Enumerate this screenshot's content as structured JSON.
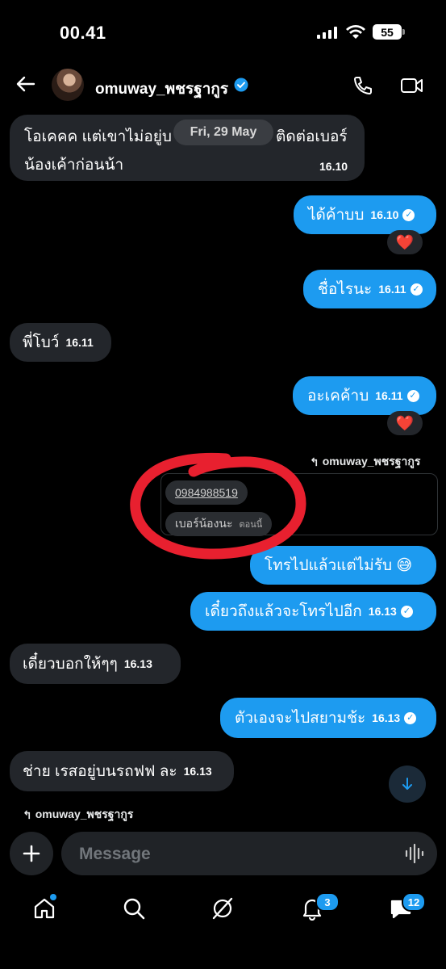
{
  "status_bar": {
    "time": "00.41",
    "battery": "55"
  },
  "header": {
    "contact_name": "omuway_พชรฐากูร"
  },
  "date_separator": "Fri, 29 May",
  "messages": [
    {
      "dir": "in",
      "text_line1": "โอเคคค แต่เขาไม่อยู่บ",
      "text_line1b": "ติดต่อเบอร์",
      "text_line2": "น้องเค้าก่อนน้า",
      "time": "16.10"
    },
    {
      "dir": "out",
      "text": "ได้ค้าบบ",
      "time": "16.10",
      "reaction": "❤️"
    },
    {
      "dir": "out",
      "text": "ชื่อไรนะ",
      "time": "16.11"
    },
    {
      "dir": "in",
      "text": "พี่โบว์",
      "time": "16.11"
    },
    {
      "dir": "out",
      "text": "อะเคค้าบ",
      "time": "16.11",
      "reaction": "❤️"
    },
    {
      "dir": "out",
      "reply_to": "omuway_พชรฐากูร",
      "quoted_number": "0984988519",
      "quoted_text": "เบอร์น้องนะ",
      "quoted_sub": "ตอนนี้",
      "text": "โทรไปแล้วแต่ไม่รับ 😅"
    },
    {
      "dir": "out",
      "text": "เดี๋ยวถึงแล้วจะโทรไปอีก",
      "time": "16.13"
    },
    {
      "dir": "in",
      "text": "เดี๋ยวบอกให้ๆๆ",
      "time": "16.13"
    },
    {
      "dir": "out",
      "text": "ตัวเองจะไปสยามช้ะ",
      "time": "16.13"
    },
    {
      "dir": "in",
      "text": "ช่าย เรสอยู่บนรถฟฟ ละ",
      "time": "16.13"
    }
  ],
  "composer": {
    "reply_to": "omuway_พชรฐากูร",
    "placeholder": "Message"
  },
  "nav": {
    "notifications_badge": "3",
    "messages_badge": "12"
  },
  "colors": {
    "accent": "#1d9bf0",
    "incoming": "#23262b",
    "annotation": "#e8202f"
  }
}
